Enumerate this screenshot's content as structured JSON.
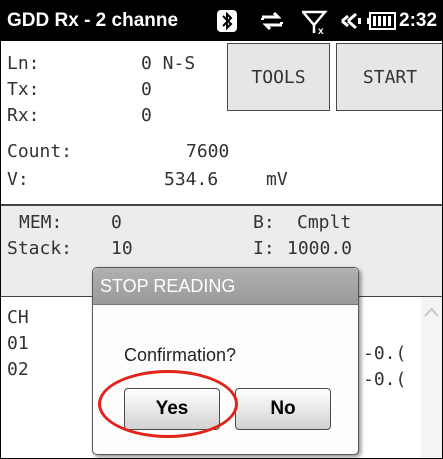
{
  "titlebar": {
    "title": "GDD Rx - 2 channe",
    "time": "2:32",
    "icons": [
      "bluetooth-icon",
      "data-transfer-icon",
      "signal-no-data-icon",
      "volume-icon",
      "battery-icon"
    ]
  },
  "info": {
    "rows": [
      {
        "label": "Ln:",
        "value": "0 N-S",
        "unit": ""
      },
      {
        "label": "Tx:",
        "value": "0",
        "unit": ""
      },
      {
        "label": "Rx:",
        "value": "0",
        "unit": ""
      },
      {
        "label": "Count:",
        "value": "7600",
        "unit": ""
      },
      {
        "label": "V:",
        "value": "534.6",
        "unit": "mV"
      }
    ],
    "tools_label": "TOOLS",
    "start_label": "START"
  },
  "status": {
    "mem_label": "MEM:",
    "mem_value": "0",
    "b_label": "B:",
    "b_value": "Cmplt",
    "stack_label": "Stack:",
    "stack_value": "10",
    "i_label": "I:",
    "i_value": "1000.0"
  },
  "list": {
    "header": "CH",
    "rows": [
      {
        "ch": "01",
        "value": "-0.("
      },
      {
        "ch": "02",
        "value": "-0.("
      }
    ]
  },
  "dialog": {
    "title": "STOP READING",
    "message": "Confirmation?",
    "yes_label": "Yes",
    "no_label": "No"
  },
  "colors": {
    "titlebar": "#000000",
    "dialog_title": "#a4a4a4",
    "highlight_ring": "#e2231a"
  }
}
